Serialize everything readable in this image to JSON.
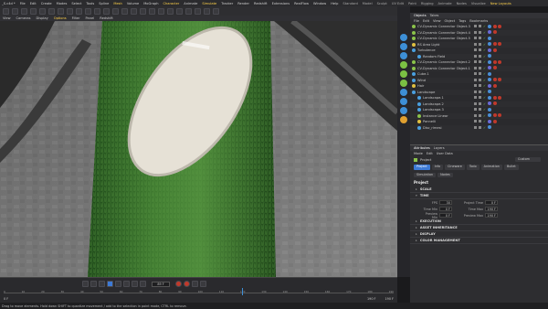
{
  "menubar": {
    "items": [
      "File",
      "Edit",
      "Create",
      "Modes",
      "Select",
      "Tools",
      "Spline",
      "Mesh",
      "Volume",
      "MoGraph",
      "Character",
      "Animate",
      "Simulate",
      "Tracker",
      "Render",
      "Redshift",
      "Extensions",
      "RealFlow",
      "Window",
      "Help"
    ],
    "workspaces": [
      "Standard",
      "Model",
      "Sculpt",
      "UV Edit",
      "Paint",
      "Rigging",
      "Animate",
      "Nodes",
      "Visualize"
    ],
    "layout": "New Layouts",
    "title_fragment": "_S.c4d *"
  },
  "viewport": {
    "menu": [
      "View",
      "Cameras",
      "Display",
      "Options",
      "Filter",
      "Panel",
      "Redshift"
    ],
    "active_menu": "Options"
  },
  "objects": {
    "tabs": [
      "Objects",
      "Takes"
    ],
    "menu": [
      "File",
      "Edit",
      "View",
      "Object",
      "Tags",
      "Bookmarks"
    ],
    "items": [
      {
        "name": "CV-Dynamic Connector Object.3",
        "color": "#8bc34a"
      },
      {
        "name": "CV-Dynamic Connector Object.4",
        "color": "#8bc34a"
      },
      {
        "name": "CV-Dynamic Connector Object.5",
        "color": "#8bc34a"
      },
      {
        "name": "RS Area Light",
        "color": "#e0c040"
      },
      {
        "name": "Turbulence",
        "color": "#4aa0e0"
      },
      {
        "name": "Random Field",
        "color": "#4aa0e0"
      },
      {
        "name": "CV-Dynamic Connector Object.2",
        "color": "#8bc34a"
      },
      {
        "name": "CV-Dynamic Connector Object.1",
        "color": "#8bc34a"
      },
      {
        "name": "Cube.1",
        "color": "#4aa0e0"
      },
      {
        "name": "Wind",
        "color": "#4aa0e0"
      },
      {
        "name": "Hair",
        "color": "#e0c040"
      },
      {
        "name": "Landscape",
        "color": "#4aa0e0"
      },
      {
        "name": "Landscape.1",
        "color": "#4aa0e0"
      },
      {
        "name": "Landscape.2",
        "color": "#4aa0e0"
      },
      {
        "name": "Landscape.3",
        "color": "#4aa0e0"
      },
      {
        "name": "Instance Linear",
        "color": "#8bc34a"
      },
      {
        "name": "Pannelli",
        "color": "#e0c040"
      },
      {
        "name": "Disc_rimesi",
        "color": "#4aa0e0"
      }
    ]
  },
  "attributes": {
    "tabs": [
      "Attributes",
      "Layers"
    ],
    "menu": [
      "Mode",
      "Edit",
      "User Data"
    ],
    "object_label": "Project",
    "dropdown": "Custom",
    "buttons_row1": [
      "Project",
      "Info",
      "Cineware",
      "Todo",
      "Animation",
      "Bullet"
    ],
    "buttons_row2": [
      "Simulation",
      "Nodes"
    ],
    "section_title": "Project",
    "sections": [
      "SCALE",
      "TIME",
      "EXECUTION",
      "ASSET INHERITANCE",
      "DISPLAY",
      "COLOR MANAGEMENT"
    ],
    "time_fields": [
      {
        "label": "FPS",
        "value": "30",
        "label2": "Project Time",
        "value2": "0 F"
      },
      {
        "label": "Time Min",
        "value": "0 F",
        "label2": "Time Max",
        "value2": "190 F"
      },
      {
        "label": "Preview Min",
        "value": "0 F",
        "label2": "Preview Max",
        "value2": "190 F"
      }
    ]
  },
  "timeline": {
    "frame": "89 F",
    "start": "0 F",
    "end_a": "190 F",
    "end_b": "190 F",
    "ticks": [
      "0",
      "10",
      "20",
      "30",
      "40",
      "50",
      "60",
      "70",
      "80",
      "90",
      "100",
      "110",
      "120",
      "130",
      "140",
      "150",
      "160",
      "170",
      "180",
      "190"
    ]
  },
  "status": "Drag to move elements. Hold down SHIFT to quantize movement / add to the selection in point mode, CTRL to remove."
}
